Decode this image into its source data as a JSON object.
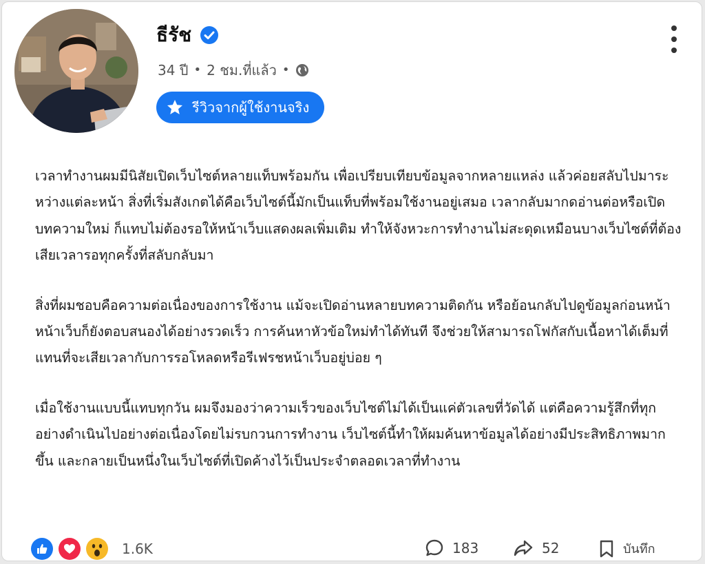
{
  "post": {
    "author": {
      "name": "ธีรัช",
      "verified": true,
      "age": "34 ปี",
      "time": "2 ชม.ที่แล้ว",
      "privacy_icon": "globe-icon"
    },
    "badge": {
      "icon": "star-icon",
      "label": "รีวิวจากผู้ใช้งานจริง",
      "color": "#1877f2"
    },
    "menu_icon": "more-vertical-icon",
    "paragraphs": [
      "เวลาทำงานผมมีนิสัยเปิดเว็บไซต์หลายแท็บพร้อมกัน เพื่อเปรียบเทียบข้อมูลจากหลายแหล่ง แล้วค่อยสลับไปมาระหว่างแต่ละหน้า สิ่งที่เริ่มสังเกตได้คือเว็บไซต์นี้มักเป็นแท็บที่พร้อมใช้งานอยู่เสมอ เวลากลับมากดอ่านต่อหรือเปิดบทความใหม่ ก็แทบไม่ต้องรอให้หน้าเว็บแสดงผลเพิ่มเติม ทำให้จังหวะการทำงานไม่สะดุดเหมือนบางเว็บไซต์ที่ต้องเสียเวลารอทุกครั้งที่สลับกลับมา",
      "สิ่งที่ผมชอบคือความต่อเนื่องของการใช้งาน แม้จะเปิดอ่านหลายบทความติดกัน หรือย้อนกลับไปดูข้อมูลก่อนหน้า หน้าเว็บก็ยังตอบสนองได้อย่างรวดเร็ว การค้นหาหัวข้อใหม่ทำได้ทันที จึงช่วยให้สามารถโฟกัสกับเนื้อหาได้เต็มที่ แทนที่จะเสียเวลากับการรอโหลดหรือรีเฟรชหน้าเว็บอยู่บ่อย ๆ",
      "เมื่อใช้งานแบบนี้แทบทุกวัน ผมจึงมองว่าความเร็วของเว็บไซต์ไม่ได้เป็นแค่ตัวเลขที่วัดได้ แต่คือความรู้สึกที่ทุกอย่างดำเนินไปอย่างต่อเนื่องโดยไม่รบกวนการทำงาน เว็บไซต์นี้ทำให้ผมค้นหาข้อมูลได้อย่างมีประสิทธิภาพมากขึ้น และกลายเป็นหนึ่งในเว็บไซต์ที่เปิดค้างไว้เป็นประจำตลอดเวลาที่ทำงาน"
    ],
    "footer": {
      "reactions": [
        "like-icon",
        "love-icon",
        "wow-icon"
      ],
      "reaction_count": "1.6K",
      "comments": "183",
      "shares": "52",
      "save_label": "บันทึก"
    }
  }
}
